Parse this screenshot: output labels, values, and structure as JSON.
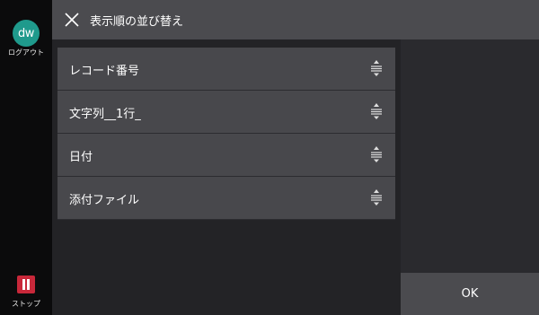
{
  "sidebar": {
    "avatar_initials": "dw",
    "logout_label": "ログアウト",
    "stop_label": "ストップ"
  },
  "header": {
    "title": "表示順の並び替え"
  },
  "list": {
    "items": [
      {
        "label": "レコード番号"
      },
      {
        "label": "文字列__1行_"
      },
      {
        "label": "日付"
      },
      {
        "label": "添付ファイル"
      }
    ]
  },
  "footer": {
    "ok_label": "OK"
  },
  "colors": {
    "avatar": "#1f9a8c",
    "stop": "#c8283a"
  },
  "icons": [
    "close-icon",
    "sort-handle-icon",
    "stop-icon"
  ]
}
